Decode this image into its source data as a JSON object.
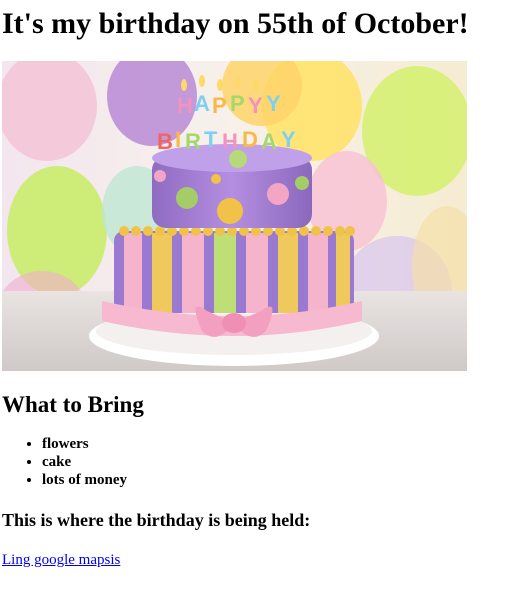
{
  "page": {
    "title": "It's my birthday on 55th of October!"
  },
  "hero_image": {
    "topper_text": "HAPPY BIRTHDAY"
  },
  "bring": {
    "heading": "What to Bring",
    "items": [
      "flowers",
      "cake",
      "lots of money"
    ]
  },
  "location": {
    "heading": "This is where the birthday is being held:",
    "link_text": "Ling google mapsis"
  }
}
